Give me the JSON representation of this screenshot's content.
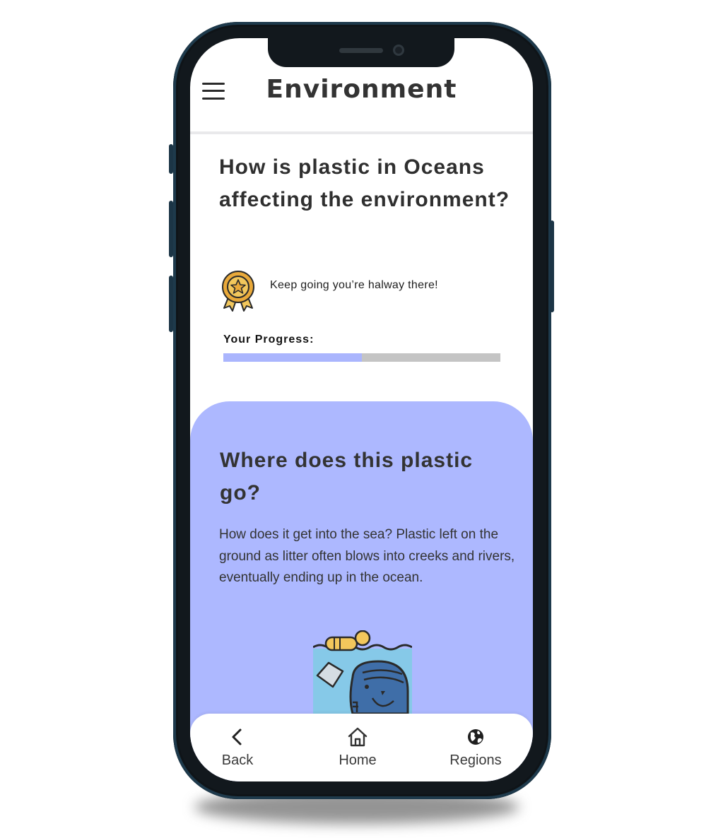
{
  "header": {
    "title": "Environment",
    "menu_icon": "hamburger-menu-icon"
  },
  "question": {
    "text": "How is plastic in Oceans affecting the environment?"
  },
  "achievement": {
    "icon": "award-medal-icon",
    "message": "Keep going you’re halway there!"
  },
  "progress": {
    "label": "Your Progress:",
    "fraction": 0.5,
    "fill_color": "#aab5fd",
    "track_color": "#c4c4c4"
  },
  "card": {
    "background": "#adb8ff",
    "title": "Where does this plastic go?",
    "body": "How does it get into the sea? Plastic left on the ground as litter often blows into creeks and rivers, eventually ending up in the ocean.",
    "illustration": "whale-ocean-plastic-illustration"
  },
  "nav": {
    "items": [
      {
        "label": "Back",
        "icon": "chevron-left-icon"
      },
      {
        "label": "Home",
        "icon": "home-icon"
      },
      {
        "label": "Regions",
        "icon": "globe-icon"
      }
    ]
  }
}
